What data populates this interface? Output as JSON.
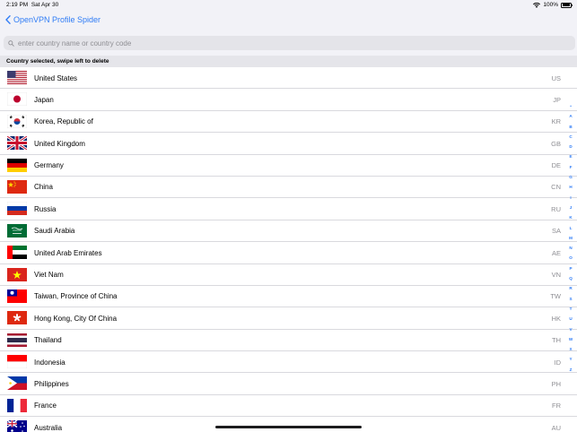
{
  "status_bar": {
    "time": "2:19 PM",
    "date": "Sat Apr 30",
    "battery": "100%"
  },
  "nav": {
    "back_label": "OpenVPN Profile Spider"
  },
  "search": {
    "placeholder": "enter country name or country code"
  },
  "section_header": "Country selected, swipe left to delete",
  "countries": [
    {
      "name": "United States",
      "code": "US",
      "flag": "us-flag-icon"
    },
    {
      "name": "Japan",
      "code": "JP",
      "flag": "jp-flag-icon"
    },
    {
      "name": "Korea, Republic of",
      "code": "KR",
      "flag": "kr-flag-icon"
    },
    {
      "name": "United Kingdom",
      "code": "GB",
      "flag": "gb-flag-icon"
    },
    {
      "name": "Germany",
      "code": "DE",
      "flag": "de-flag-icon"
    },
    {
      "name": "China",
      "code": "CN",
      "flag": "cn-flag-icon"
    },
    {
      "name": "Russia",
      "code": "RU",
      "flag": "ru-flag-icon"
    },
    {
      "name": "Saudi Arabia",
      "code": "SA",
      "flag": "sa-flag-icon"
    },
    {
      "name": "United Arab Emirates",
      "code": "AE",
      "flag": "ae-flag-icon"
    },
    {
      "name": "Viet Nam",
      "code": "VN",
      "flag": "vn-flag-icon"
    },
    {
      "name": "Taiwan, Province of China",
      "code": "TW",
      "flag": "tw-flag-icon"
    },
    {
      "name": "Hong Kong, City Of China",
      "code": "HK",
      "flag": "hk-flag-icon"
    },
    {
      "name": "Thailand",
      "code": "TH",
      "flag": "th-flag-icon"
    },
    {
      "name": "Indonesia",
      "code": "ID",
      "flag": "id-flag-icon"
    },
    {
      "name": "Philippines",
      "code": "PH",
      "flag": "ph-flag-icon"
    },
    {
      "name": "France",
      "code": "FR",
      "flag": "fr-flag-icon"
    },
    {
      "name": "Australia",
      "code": "AU",
      "flag": "au-flag-icon"
    }
  ],
  "section_index": [
    "•",
    "A",
    "B",
    "C",
    "D",
    "E",
    "F",
    "G",
    "H",
    "I",
    "J",
    "K",
    "L",
    "M",
    "N",
    "O",
    "P",
    "Q",
    "R",
    "S",
    "T",
    "U",
    "V",
    "W",
    "X",
    "Y",
    "Z"
  ],
  "colors": {
    "accent": "#2f7cf6",
    "secondary_text": "#8e8e93",
    "bar_background": "#f2f2f7",
    "header_background": "#e5e5ea"
  }
}
